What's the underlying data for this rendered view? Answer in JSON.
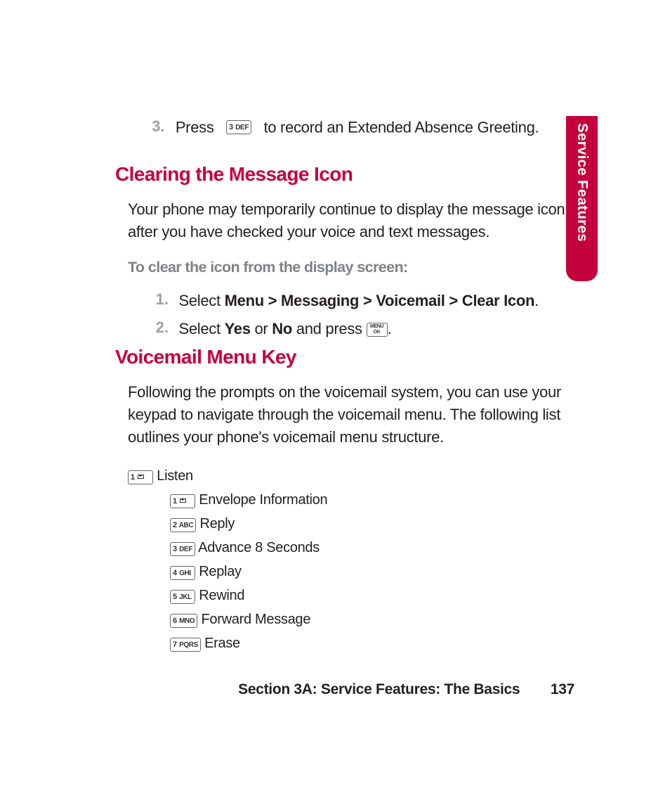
{
  "side_tab": {
    "label": "Service Features"
  },
  "step3": {
    "number": "3.",
    "before": "Press",
    "key": {
      "digit": "3",
      "letters": "DEF"
    },
    "after": "to record an Extended Absence Greeting."
  },
  "section1": {
    "heading": "Clearing the Message Icon",
    "body": "Your phone may temporarily continue to display the message icon after you have checked your voice and text messages.",
    "subhead": "To clear the icon from the display screen:",
    "steps": [
      {
        "number": "1.",
        "prefix": "Select ",
        "bold": "Menu >  Messaging > Voicemail > Clear Icon",
        "suffix": "."
      },
      {
        "number": "2.",
        "prefix": "Select ",
        "bold1": "Yes",
        "mid1": " or ",
        "bold2": "No",
        "mid2": " and press ",
        "key_label_top": "MENU",
        "key_label_bot": "OK",
        "suffix": "."
      }
    ]
  },
  "section2": {
    "heading": "Voicemail Menu Key",
    "body": "Following the prompts on the voicemail system, you can use your keypad to navigate through the voicemail menu. The following list outlines your phone's voicemail menu structure.",
    "tree": {
      "root": {
        "key": {
          "digit": "1",
          "icon": "envelope"
        },
        "label": "Listen"
      },
      "children": [
        {
          "key": {
            "digit": "1",
            "icon": "envelope"
          },
          "label": "Envelope Information"
        },
        {
          "key": {
            "digit": "2",
            "letters": "ABC"
          },
          "label": "Reply"
        },
        {
          "key": {
            "digit": "3",
            "letters": "DEF"
          },
          "label": "Advance 8 Seconds"
        },
        {
          "key": {
            "digit": "4",
            "letters": "GHI"
          },
          "label": "Replay"
        },
        {
          "key": {
            "digit": "5",
            "letters": "JKL"
          },
          "label": "Rewind"
        },
        {
          "key": {
            "digit": "6",
            "letters": "MNO"
          },
          "label": "Forward Message"
        },
        {
          "key": {
            "digit": "7",
            "letters": "PQRS"
          },
          "label": "Erase"
        }
      ]
    }
  },
  "footer": {
    "section": "Section 3A: Service Features: The Basics",
    "page": "137"
  }
}
